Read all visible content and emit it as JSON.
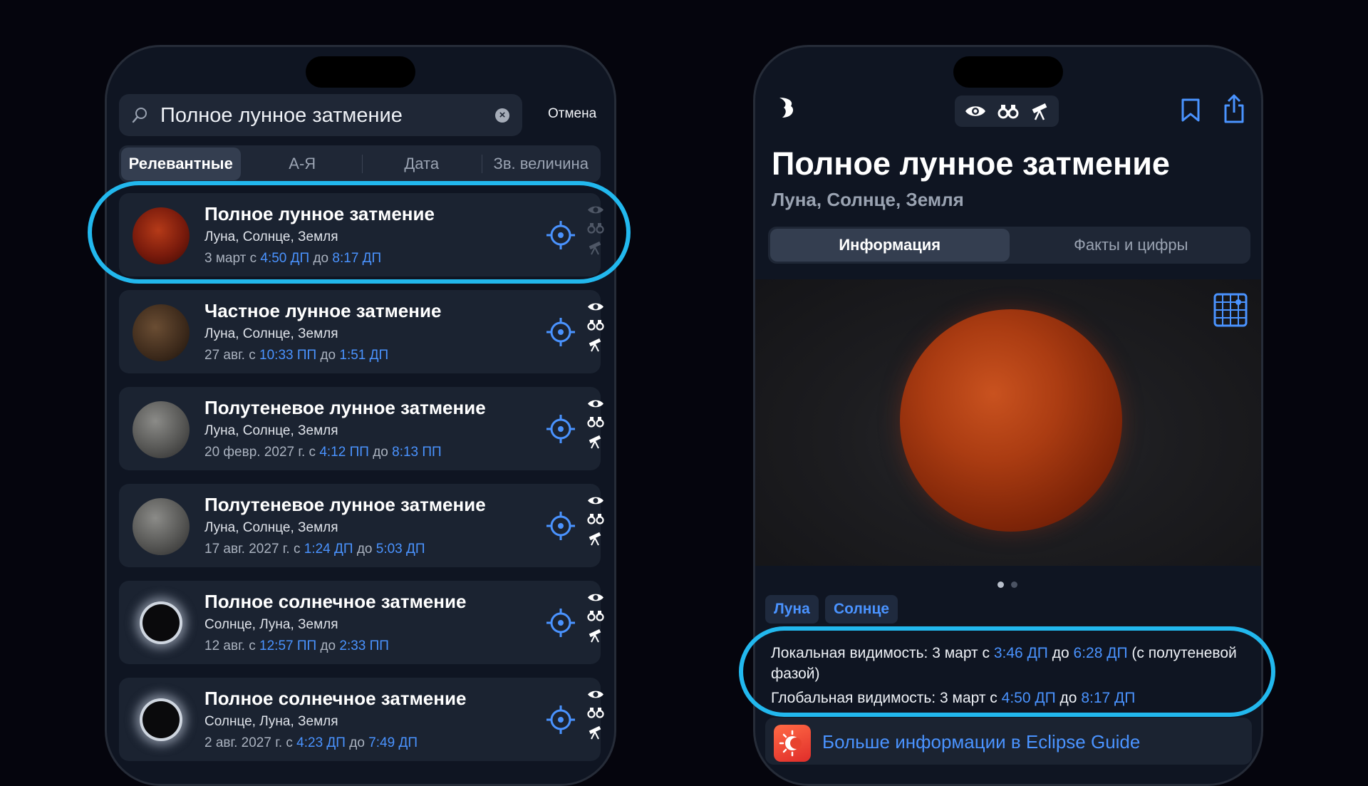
{
  "search": {
    "query": "Полное лунное затмение",
    "cancel_label": "Отмена"
  },
  "sort_tabs": [
    "Релевантные",
    "А-Я",
    "Дата",
    "Зв. величина"
  ],
  "results": [
    {
      "title": "Полное лунное затмение",
      "subtitle": "Луна, Солнце, Земля",
      "date_prefix": "3 март с",
      "start": "4:50 ДП",
      "mid": "до",
      "end": "8:17 ДП",
      "thumb": "red-moon",
      "visibility_dimmed": true
    },
    {
      "title": "Частное лунное затмение",
      "subtitle": "Луна, Солнце, Земля",
      "date_prefix": "27 авг. с",
      "start": "10:33 ПП",
      "mid": "до",
      "end": "1:51 ДП",
      "thumb": "partial-moon",
      "visibility_dimmed": false
    },
    {
      "title": "Полутеневое лунное затмение",
      "subtitle": "Луна, Солнце, Земля",
      "date_prefix": "20 февр. 2027 г. с",
      "start": "4:12 ПП",
      "mid": "до",
      "end": "8:13 ПП",
      "thumb": "gray-moon",
      "visibility_dimmed": false
    },
    {
      "title": "Полутеневое лунное затмение",
      "subtitle": "Луна, Солнце, Земля",
      "date_prefix": "17 авг. 2027 г. с",
      "start": "1:24 ДП",
      "mid": "до",
      "end": "5:03 ДП",
      "thumb": "gray-moon",
      "visibility_dimmed": false
    },
    {
      "title": "Полное солнечное затмение",
      "subtitle": "Солнце, Луна, Земля",
      "date_prefix": "12 авг. с",
      "start": "12:57 ПП",
      "mid": "до",
      "end": "2:33 ПП",
      "thumb": "solar-corona",
      "visibility_dimmed": false
    },
    {
      "title": "Полное солнечное затмение",
      "subtitle": "Солнце, Луна, Земля",
      "date_prefix": "2 авг. 2027 г. с",
      "start": "4:23 ДП",
      "mid": "до",
      "end": "7:49 ДП",
      "thumb": "solar-corona",
      "visibility_dimmed": false
    }
  ],
  "detail": {
    "title": "Полное лунное затмение",
    "subtitle": "Луна, Солнце, Земля",
    "tabs": [
      "Информация",
      "Факты и цифры"
    ],
    "chips": [
      "Луна",
      "Солнце"
    ],
    "local_label": "Локальная видимость:",
    "local_prefix": "3 март с",
    "local_start": "3:46 ДП",
    "local_mid": "до",
    "local_end": "6:28 ДП",
    "local_suffix": "(с полутеневой фазой)",
    "global_label": "Глобальная видимость:",
    "global_prefix": "3 март с",
    "global_start": "4:50 ДП",
    "global_mid": "до",
    "global_end": "8:17 ДП",
    "guide_link": "Больше информации в Eclipse Guide"
  },
  "colors": {
    "accent": "#4a93ff",
    "highlight": "#22b8ee",
    "background": "#05050d",
    "panel": "#1b2331"
  }
}
